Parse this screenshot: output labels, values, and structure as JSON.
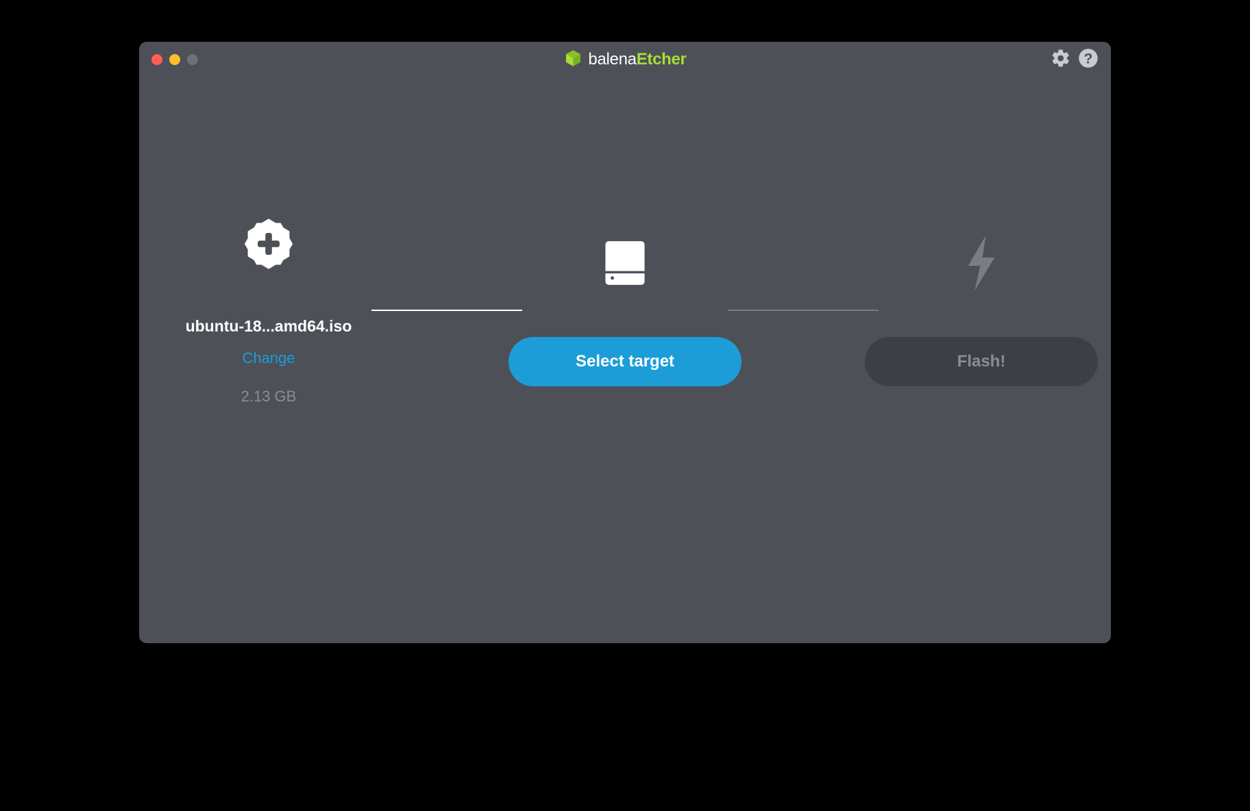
{
  "app": {
    "brand_word1": "balena",
    "brand_word2": "Etcher"
  },
  "steps": {
    "image": {
      "file_name": "ubuntu-18...amd64.iso",
      "change_label": "Change",
      "size_label": "2.13 GB"
    },
    "target": {
      "button_label": "Select target"
    },
    "flash": {
      "button_label": "Flash!"
    }
  },
  "colors": {
    "accent_green": "#a5de37",
    "accent_blue": "#1c9dd8",
    "window_bg": "#4d5057"
  }
}
